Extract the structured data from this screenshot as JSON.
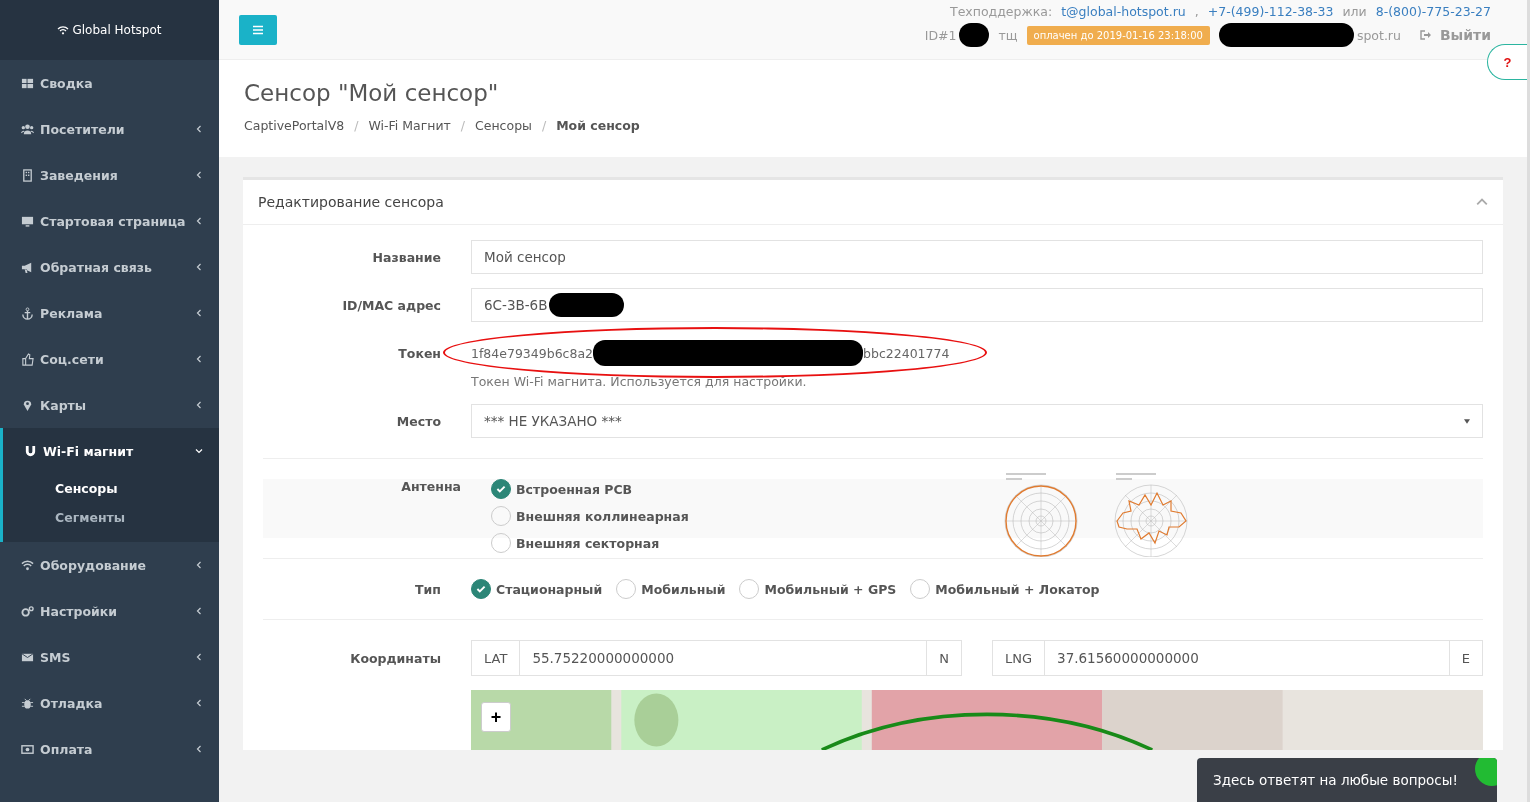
{
  "sidebar": {
    "brand": "Global Hotspot",
    "items": [
      {
        "label": "Сводка",
        "has_children": false,
        "expanded": false
      },
      {
        "label": "Посетители",
        "has_children": true,
        "expanded": false
      },
      {
        "label": "Заведения",
        "has_children": true,
        "expanded": false
      },
      {
        "label": "Стартовая страница",
        "has_children": true,
        "expanded": false
      },
      {
        "label": "Обратная связь",
        "has_children": true,
        "expanded": false
      },
      {
        "label": "Реклама",
        "has_children": true,
        "expanded": false
      },
      {
        "label": "Соц.сети",
        "has_children": true,
        "expanded": false
      },
      {
        "label": "Карты",
        "has_children": true,
        "expanded": false
      },
      {
        "label": "Wi-Fi магнит",
        "has_children": true,
        "expanded": true,
        "children": [
          {
            "label": "Сенсоры",
            "selected": true
          },
          {
            "label": "Сегменты",
            "selected": false
          }
        ]
      },
      {
        "label": "Оборудование",
        "has_children": true,
        "expanded": false
      },
      {
        "label": "Настройки",
        "has_children": true,
        "expanded": false
      },
      {
        "label": "SMS",
        "has_children": true,
        "expanded": false
      },
      {
        "label": "Отладка",
        "has_children": true,
        "expanded": false
      },
      {
        "label": "Оплата",
        "has_children": true,
        "expanded": false
      }
    ]
  },
  "header": {
    "support_label": "Техподдержка:",
    "email": "t@global-hotspot.ru",
    "separator": ",",
    "phone_1": "+7-(499)-112-38-33",
    "or": "или",
    "phone_2": "8-(800)-775-23-27",
    "account_id": "ID#1",
    "account_name": "тщ",
    "paid_badge": "оплачен до 2019-01-16 23:18:00",
    "account_email_tail": "spot.ru",
    "logout": "Выйти",
    "help": "?"
  },
  "page": {
    "title": "Сенсор \"Мой сенсор\"",
    "breadcrumbs": [
      {
        "label": "CaptivePortalV8",
        "current": false
      },
      {
        "label": "Wi-Fi Магнит",
        "current": false
      },
      {
        "label": "Сенсоры",
        "current": false
      },
      {
        "label": "Мой сенсор",
        "current": true
      }
    ],
    "breadcrumb_separator": "/"
  },
  "card": {
    "title": "Редактирование сенсора",
    "name": {
      "label": "Название",
      "value": "Мой сенсор"
    },
    "mac": {
      "label": "ID/MAC адрес",
      "value": "6C-3B-6B"
    },
    "token": {
      "label": "Токен",
      "start": "1f84e79349b6c8a2",
      "end": "bbc22401774",
      "help": "Токен Wi-Fi магнита. Используется для настройки."
    },
    "place": {
      "label": "Место",
      "value": "*** НЕ УКАЗАНО ***"
    },
    "antenna": {
      "label": "Антенна",
      "options": [
        {
          "label": "Встроенная PCB",
          "checked": true
        },
        {
          "label": "Внешняя коллинеарная",
          "checked": false
        },
        {
          "label": "Внешняя секторная",
          "checked": false
        }
      ]
    },
    "type": {
      "label": "Тип",
      "options": [
        {
          "label": "Стационарный",
          "checked": true
        },
        {
          "label": "Мобильный",
          "checked": false
        },
        {
          "label": "Мобильный + GPS",
          "checked": false
        },
        {
          "label": "Мобильный + Локатор",
          "checked": false
        }
      ]
    },
    "coordinates": {
      "label": "Координаты",
      "lat": {
        "prefix": "LAT",
        "value": "55.75220000000000",
        "suffix": "N"
      },
      "lng": {
        "prefix": "LNG",
        "value": "37.61560000000000",
        "suffix": "E"
      }
    },
    "map_zoom_in": "+"
  },
  "chat": {
    "text": "Здесь ответят на любые вопросы!"
  }
}
